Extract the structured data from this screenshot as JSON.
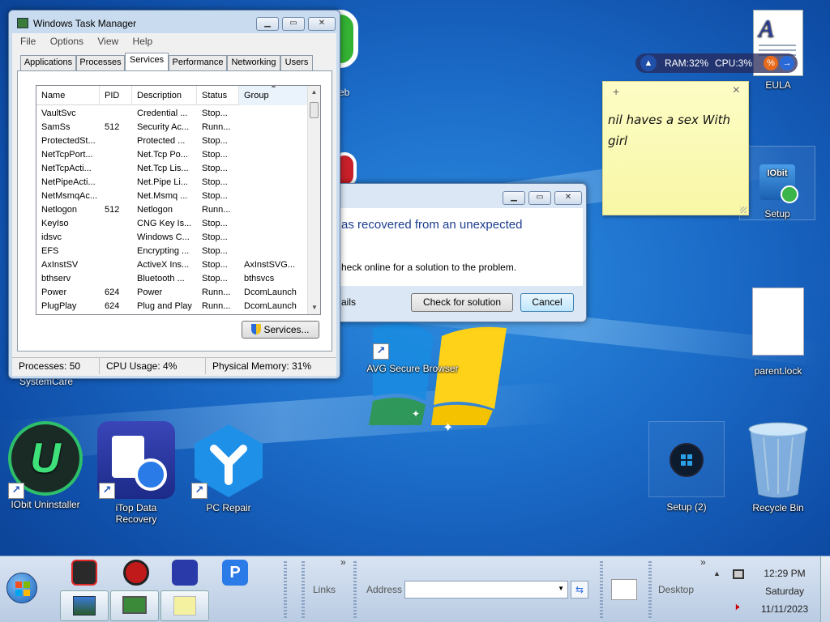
{
  "desktop": {
    "icons": {
      "eula": "EULA",
      "setup": "Setup",
      "parent_lock": "parent.lock",
      "setup2": "Setup (2)",
      "recycle_bin": "Recycle Bin",
      "avg_browser": "AVG Secure Browser",
      "iobit_uninstaller": "IObit Uninstaller",
      "itop_recovery": "iTop Data Recovery",
      "pc_repair": "PC Repair",
      "systemcare": "SystemCare",
      "partial_web": "eb",
      "iobit_badge": "IObit"
    },
    "colors": {
      "wallpaper": "#1b6cc8"
    }
  },
  "monitor_widget": {
    "ram": "RAM:32%",
    "cpu": "CPU:3%"
  },
  "sticky_note": {
    "add_glyph": "+",
    "close_glyph": "×",
    "line1": "nil haves a sex With",
    "line2": "girl"
  },
  "error_dialog": {
    "heading": "as recovered from an unexpected",
    "body": "heck online for a solution to the problem.",
    "details": "ails",
    "check_button": "Check for solution",
    "cancel_button": "Cancel"
  },
  "task_manager": {
    "title": "Windows Task Manager",
    "menu": [
      "File",
      "Options",
      "View",
      "Help"
    ],
    "tabs": [
      "Applications",
      "Processes",
      "Services",
      "Performance",
      "Networking",
      "Users"
    ],
    "active_tab": "Services",
    "columns": [
      "Name",
      "PID",
      "Description",
      "Status",
      "Group"
    ],
    "rows": [
      {
        "name": "VaultSvc",
        "pid": "",
        "desc": "Credential ...",
        "status": "Stop...",
        "group": ""
      },
      {
        "name": "SamSs",
        "pid": "512",
        "desc": "Security Ac...",
        "status": "Runn...",
        "group": ""
      },
      {
        "name": "ProtectedSt...",
        "pid": "",
        "desc": "Protected ...",
        "status": "Stop...",
        "group": ""
      },
      {
        "name": "NetTcpPort...",
        "pid": "",
        "desc": "Net.Tcp Po...",
        "status": "Stop...",
        "group": ""
      },
      {
        "name": "NetTcpActi...",
        "pid": "",
        "desc": "Net.Tcp Lis...",
        "status": "Stop...",
        "group": ""
      },
      {
        "name": "NetPipeActi...",
        "pid": "",
        "desc": "Net.Pipe Li...",
        "status": "Stop...",
        "group": ""
      },
      {
        "name": "NetMsmqAc...",
        "pid": "",
        "desc": "Net.Msmq ...",
        "status": "Stop...",
        "group": ""
      },
      {
        "name": "Netlogon",
        "pid": "512",
        "desc": "Netlogon",
        "status": "Runn...",
        "group": ""
      },
      {
        "name": "KeyIso",
        "pid": "",
        "desc": "CNG Key Is...",
        "status": "Stop...",
        "group": ""
      },
      {
        "name": "idsvc",
        "pid": "",
        "desc": "Windows C...",
        "status": "Stop...",
        "group": ""
      },
      {
        "name": "EFS",
        "pid": "",
        "desc": "Encrypting ...",
        "status": "Stop...",
        "group": ""
      },
      {
        "name": "AxInstSV",
        "pid": "",
        "desc": "ActiveX Ins...",
        "status": "Stop...",
        "group": "AxInstSVG..."
      },
      {
        "name": "bthserv",
        "pid": "",
        "desc": "Bluetooth ...",
        "status": "Stop...",
        "group": "bthsvcs"
      },
      {
        "name": "Power",
        "pid": "624",
        "desc": "Power",
        "status": "Runn...",
        "group": "DcomLaunch"
      },
      {
        "name": "PlugPlay",
        "pid": "624",
        "desc": "Plug and Play",
        "status": "Runn...",
        "group": "DcomLaunch"
      }
    ],
    "services_button": "Services...",
    "status": {
      "processes": "Processes: 50",
      "cpu": "CPU Usage: 4%",
      "memory": "Physical Memory: 31%"
    }
  },
  "taskbar": {
    "links": "Links",
    "address_label": "Address",
    "address_value": "",
    "desktop": "Desktop",
    "chevron": "»",
    "time": "12:29 PM",
    "day": "Saturday",
    "date": "11/11/2023"
  }
}
